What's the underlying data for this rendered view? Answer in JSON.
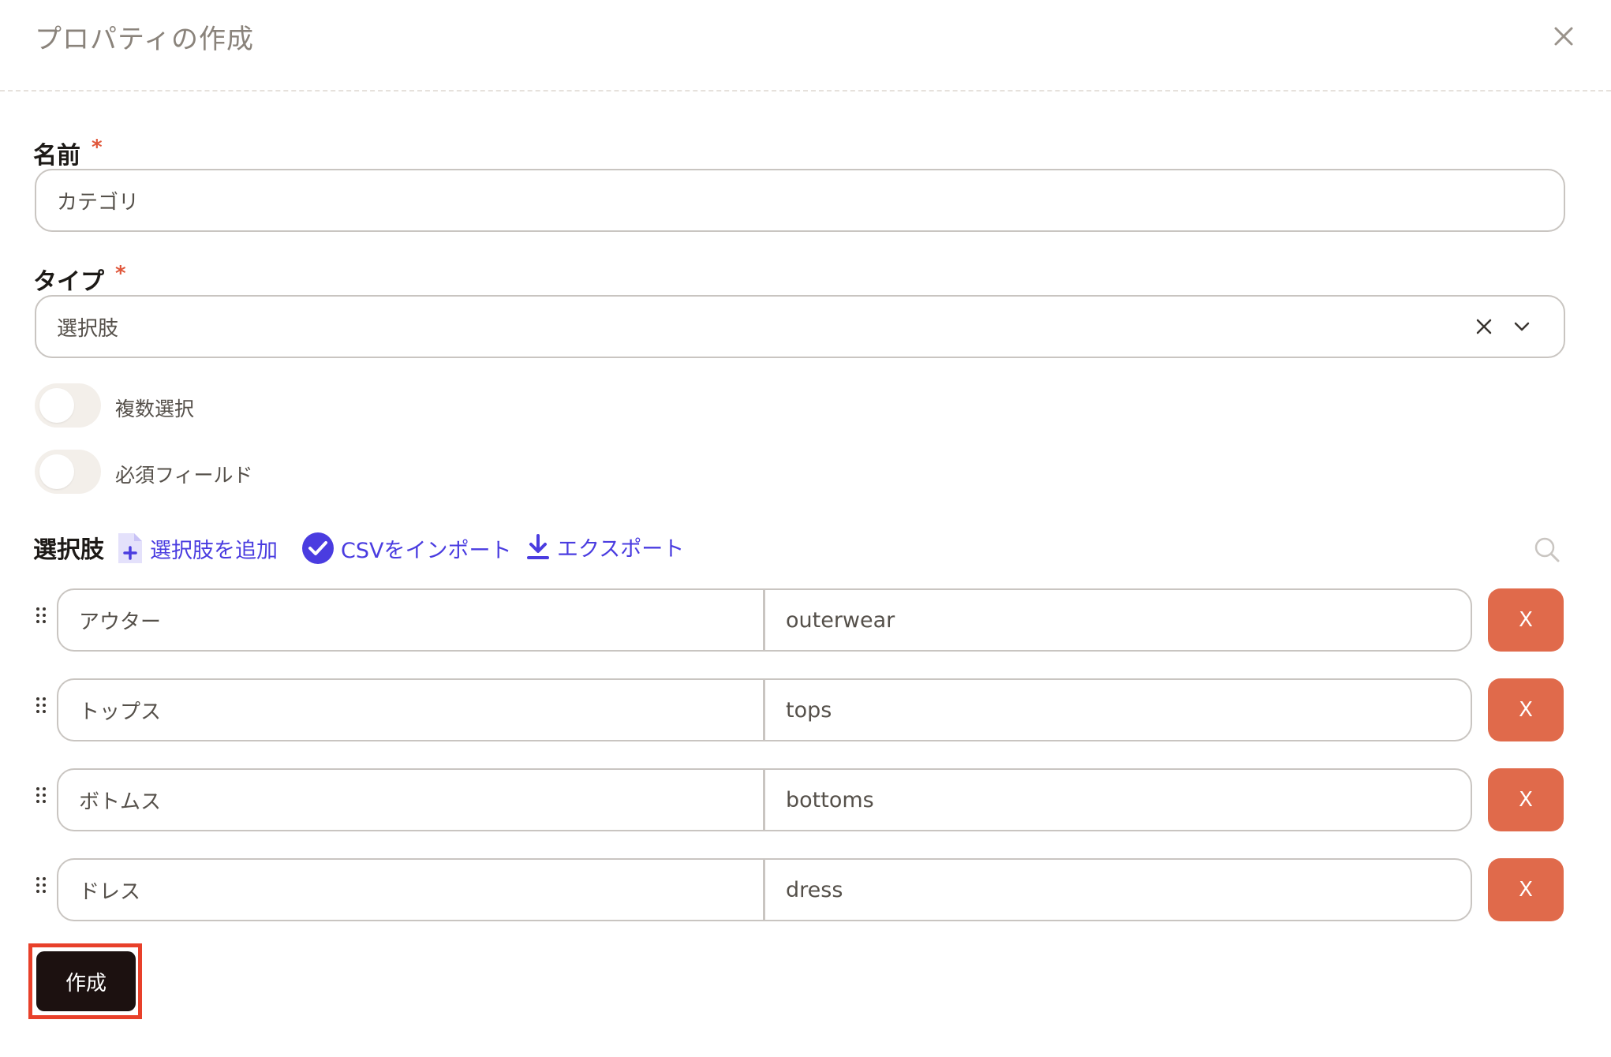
{
  "dialog": {
    "title": "プロパティの作成"
  },
  "name_field": {
    "label": "名前",
    "required_mark": "*",
    "value": "カテゴリ"
  },
  "type_field": {
    "label": "タイプ",
    "required_mark": "*",
    "value": "選択肢"
  },
  "toggles": {
    "multi_select": {
      "label": "複数選択",
      "on": false
    },
    "required_field": {
      "label": "必須フィールド",
      "on": false
    }
  },
  "options": {
    "title": "選択肢",
    "add_label": "選択肢を追加",
    "import_label": "CSVをインポート",
    "export_label": "エクスポート",
    "items": [
      {
        "label": "アウター",
        "value": "outerwear",
        "delete_label": "X"
      },
      {
        "label": "トップス",
        "value": "tops",
        "delete_label": "X"
      },
      {
        "label": "ボトムス",
        "value": "bottoms",
        "delete_label": "X"
      },
      {
        "label": "ドレス",
        "value": "dress",
        "delete_label": "X"
      }
    ]
  },
  "footer": {
    "create_label": "作成"
  },
  "colors": {
    "accent": "#4a3ce0",
    "danger": "#e06a4b",
    "required": "#e0573b",
    "primary_button": "#1c1110",
    "highlight_border": "#e8402a"
  }
}
